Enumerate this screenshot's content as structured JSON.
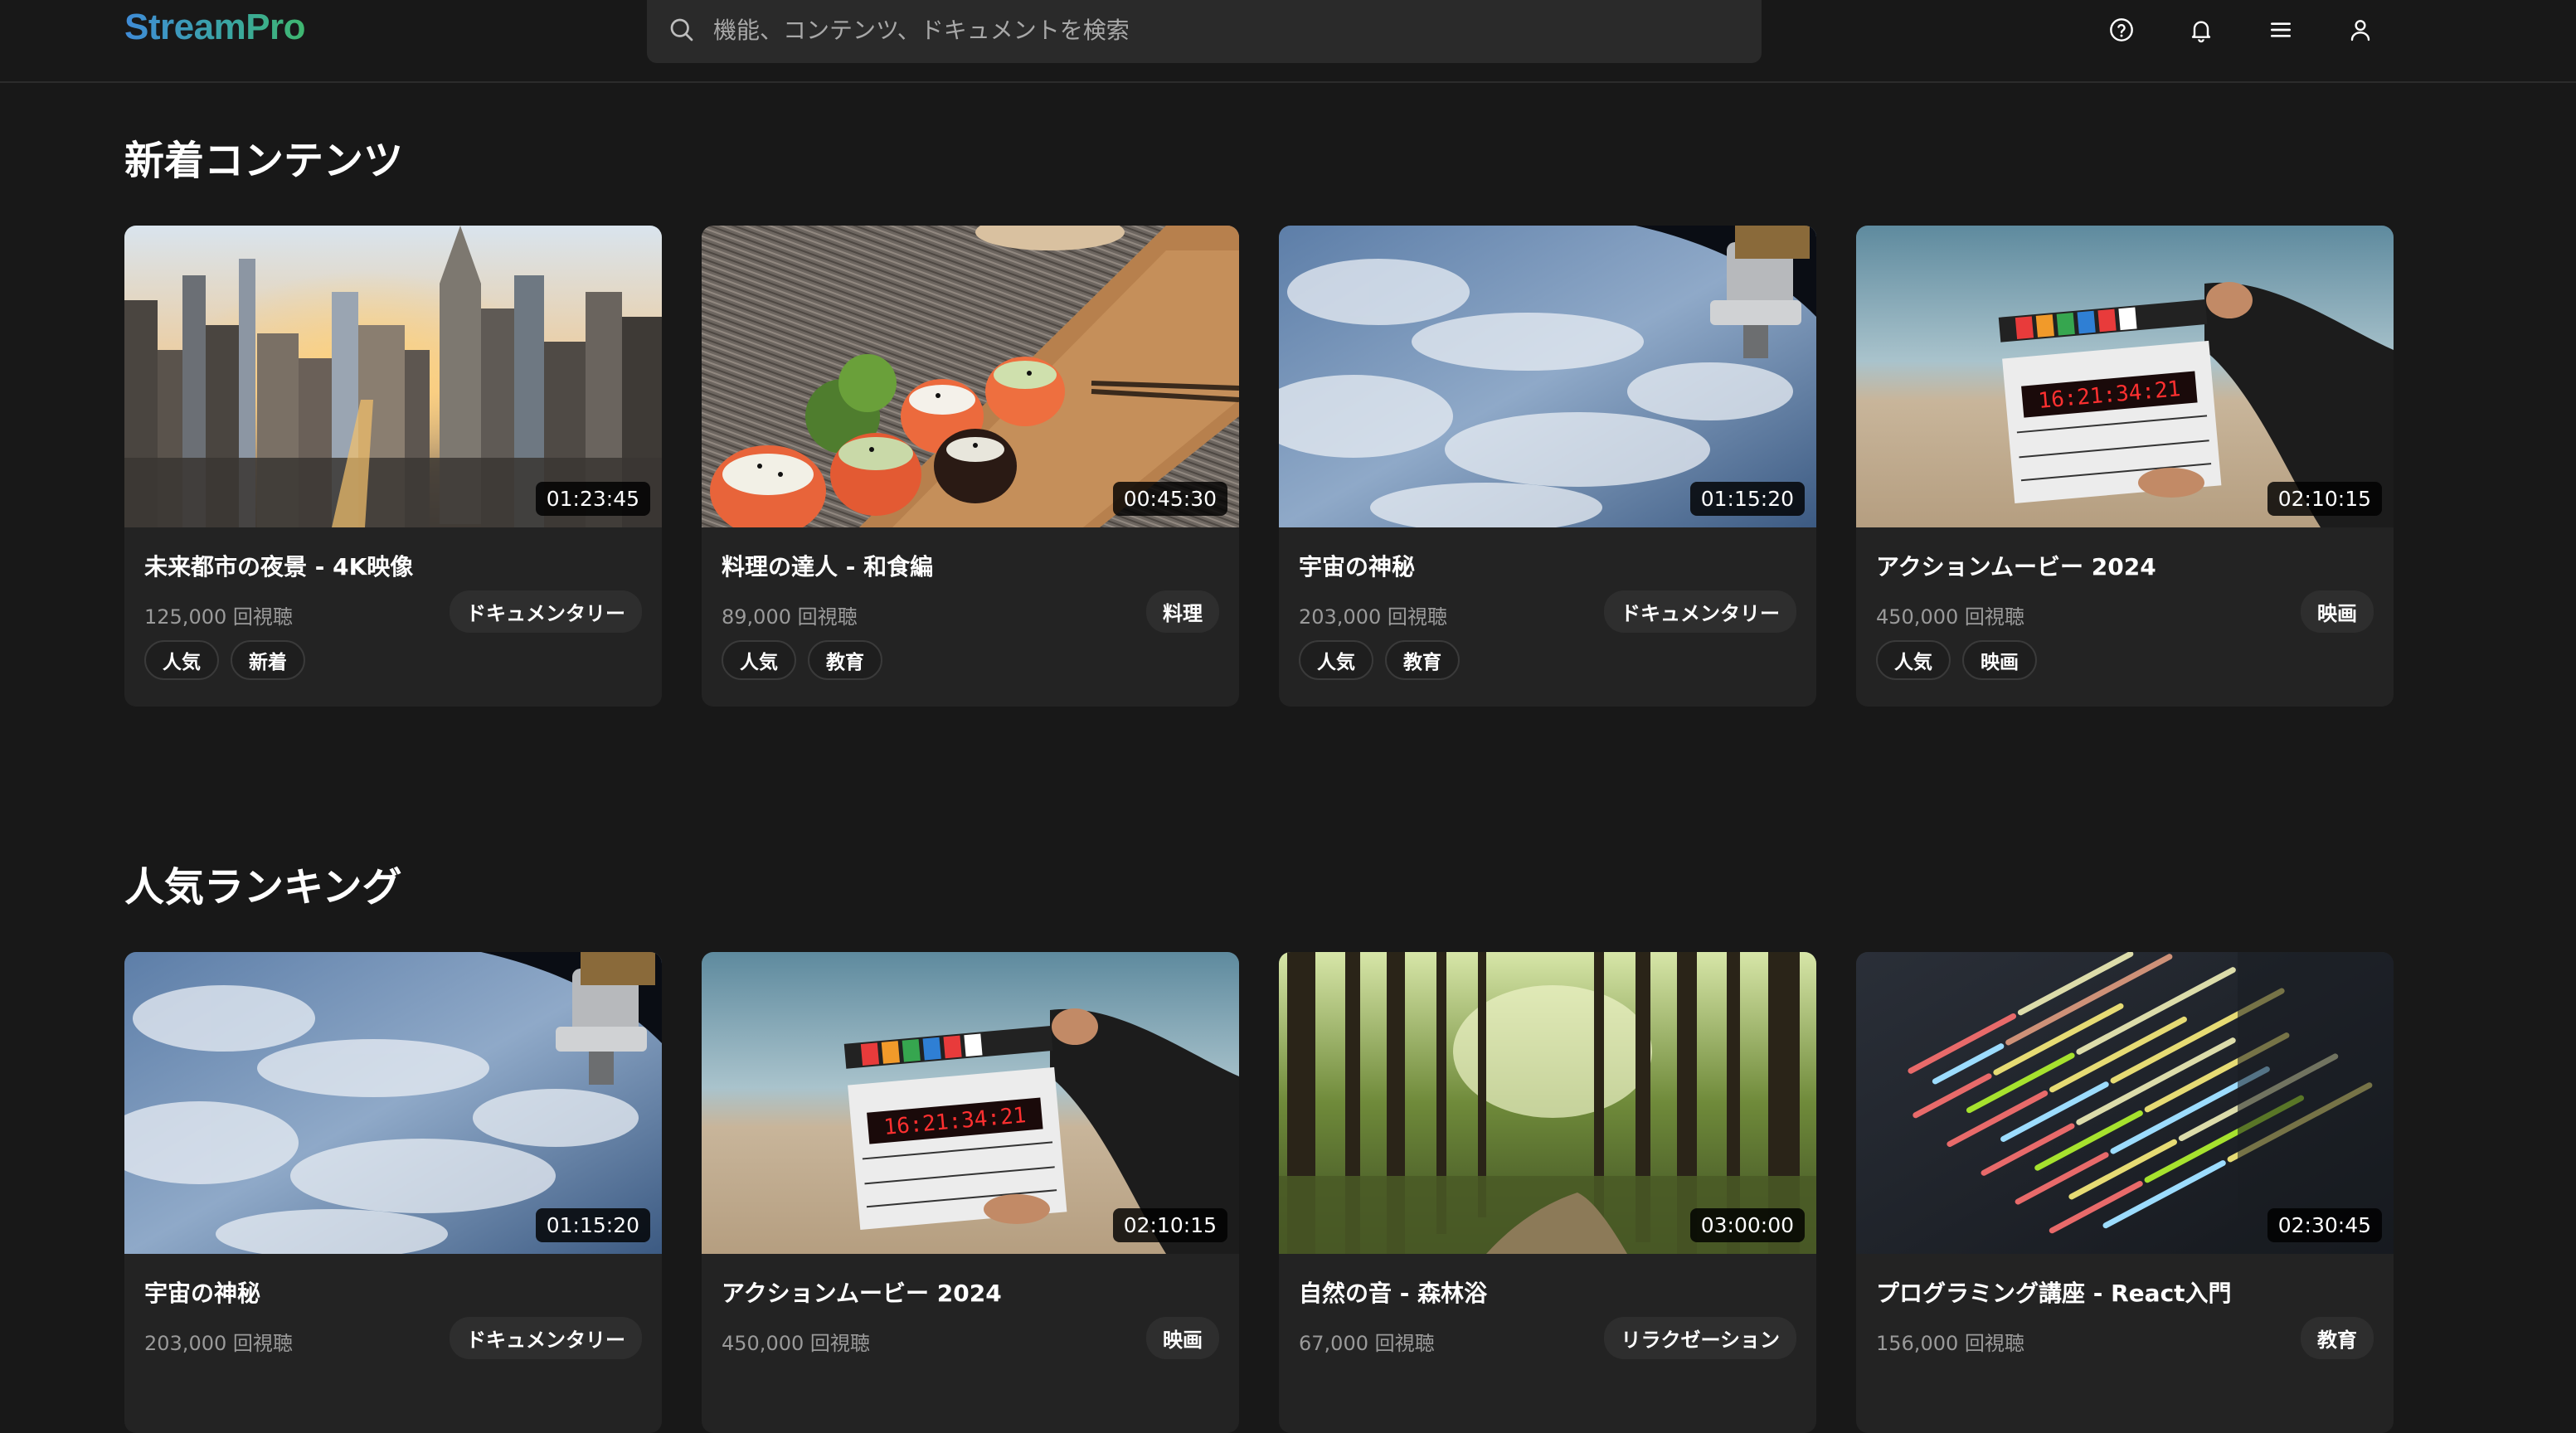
{
  "header": {
    "logo": "StreamPro",
    "search_placeholder": "機能、コンテンツ、ドキュメントを検索",
    "icons": [
      "help-circle-icon",
      "bell-icon",
      "menu-icon",
      "user-icon"
    ]
  },
  "sections": [
    {
      "title": "新着コンテンツ",
      "cards": [
        {
          "title": "未来都市の夜景 - 4K映像",
          "duration": "01:23:45",
          "views": "125,000 回視聴",
          "category": "ドキュメンタリー",
          "tags": [
            "人気",
            "新着"
          ],
          "thumbnail": "city-skyline"
        },
        {
          "title": "料理の達人 - 和食編",
          "duration": "00:45:30",
          "views": "89,000 回視聴",
          "category": "料理",
          "tags": [
            "人気",
            "教育"
          ],
          "thumbnail": "sushi"
        },
        {
          "title": "宇宙の神秘",
          "duration": "01:15:20",
          "views": "203,000 回視聴",
          "category": "ドキュメンタリー",
          "tags": [
            "人気",
            "教育"
          ],
          "thumbnail": "earth-from-space"
        },
        {
          "title": "アクションムービー 2024",
          "duration": "02:10:15",
          "views": "450,000 回視聴",
          "category": "映画",
          "tags": [
            "人気",
            "映画"
          ],
          "thumbnail": "clapperboard"
        }
      ]
    },
    {
      "title": "人気ランキング",
      "cards": [
        {
          "title": "宇宙の神秘",
          "duration": "01:15:20",
          "views": "203,000 回視聴",
          "category": "ドキュメンタリー",
          "tags": [],
          "thumbnail": "earth-from-space"
        },
        {
          "title": "アクションムービー 2024",
          "duration": "02:10:15",
          "views": "450,000 回視聴",
          "category": "映画",
          "tags": [],
          "thumbnail": "clapperboard"
        },
        {
          "title": "自然の音 - 森林浴",
          "duration": "03:00:00",
          "views": "67,000 回視聴",
          "category": "リラクゼーション",
          "tags": [],
          "thumbnail": "forest"
        },
        {
          "title": "プログラミング講座 - React入門",
          "duration": "02:30:45",
          "views": "156,000 回視聴",
          "category": "教育",
          "tags": [],
          "thumbnail": "code-screen"
        }
      ]
    }
  ]
}
